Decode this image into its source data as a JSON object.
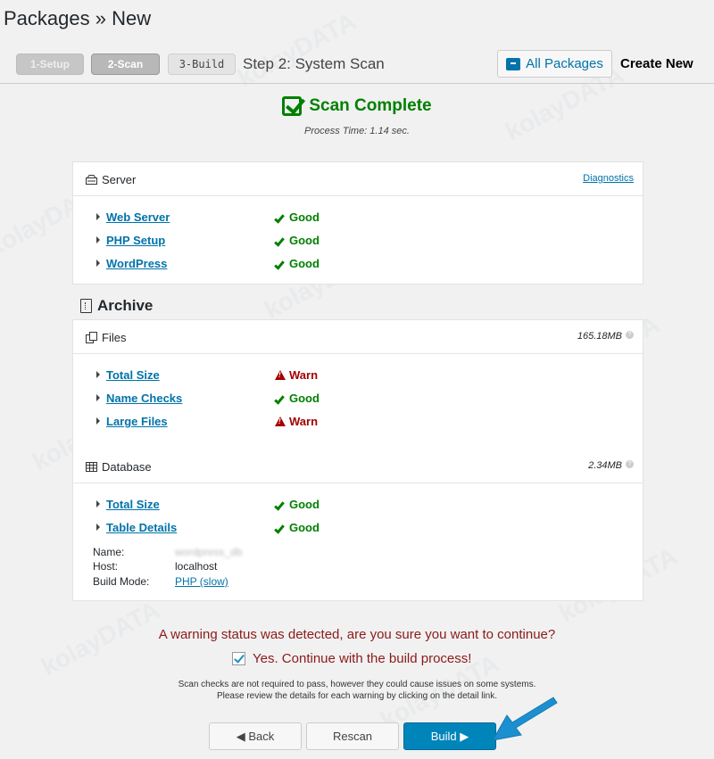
{
  "page": {
    "title": "Packages » New"
  },
  "steps": {
    "step1": "1-Setup",
    "step2": "2-Scan",
    "step3": "3-Build",
    "caption": "Step 2: System Scan"
  },
  "header_actions": {
    "all_packages": "All Packages",
    "create_new": "Create New"
  },
  "scan": {
    "title": "Scan Complete",
    "process_time": "Process Time: 1.14 sec."
  },
  "server": {
    "title": "Server",
    "diagnostics": "Diagnostics",
    "items": [
      {
        "name": "Web Server",
        "status": "Good"
      },
      {
        "name": "PHP Setup",
        "status": "Good"
      },
      {
        "name": "WordPress",
        "status": "Good"
      }
    ]
  },
  "archive": {
    "title": "Archive",
    "files": {
      "title": "Files",
      "size": "165.18MB",
      "items": [
        {
          "name": "Total Size",
          "status": "Warn"
        },
        {
          "name": "Name Checks",
          "status": "Good"
        },
        {
          "name": "Large Files",
          "status": "Warn"
        }
      ]
    },
    "database": {
      "title": "Database",
      "size": "2.34MB",
      "items": [
        {
          "name": "Total Size",
          "status": "Good"
        },
        {
          "name": "Table Details",
          "status": "Good"
        }
      ],
      "info": {
        "name_label": "Name:",
        "name_value": "wordpress_db",
        "host_label": "Host:",
        "host_value": "localhost",
        "mode_label": "Build Mode:",
        "mode_value": "PHP (slow)"
      }
    }
  },
  "footer": {
    "warning": "A warning status was detected, are you sure you want to continue?",
    "confirm": "Yes. Continue with the build process!",
    "note1": "Scan checks are not required to pass, however they could cause issues on some systems.",
    "note2": "Please review the details for each warning by clicking on the detail link."
  },
  "buttons": {
    "back": "◀ Back",
    "rescan": "Rescan",
    "build": "Build ▶"
  },
  "watermark": "kolayDATA",
  "colors": {
    "good": "#008000",
    "warn": "#a30000",
    "link": "#0073aa",
    "primary": "#0085ba"
  }
}
